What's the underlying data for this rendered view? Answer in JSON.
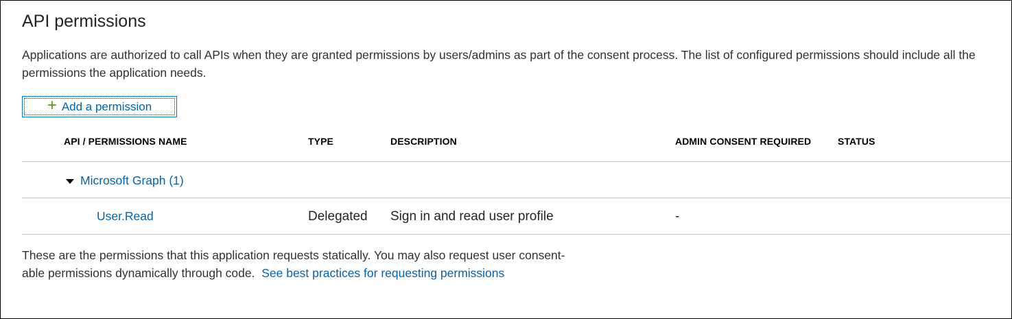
{
  "page": {
    "title": "API permissions",
    "intro": "Applications are authorized to call APIs when they are granted permissions by users/admins as part of the consent process. The list of configured permissions should include all the permissions the application needs."
  },
  "toolbar": {
    "add_permission_icon": "+",
    "add_permission_label": "Add a permission"
  },
  "table": {
    "columns": [
      "API / PERMISSIONS NAME",
      "TYPE",
      "DESCRIPTION",
      "ADMIN CONSENT REQUIRED",
      "STATUS"
    ],
    "groups": [
      {
        "label": "Microsoft Graph (1)",
        "rows": [
          {
            "name": "User.Read",
            "type": "Delegated",
            "description": "Sign in and read user profile",
            "admin_consent": "-",
            "status": ""
          }
        ]
      }
    ]
  },
  "footer": {
    "line1": "These are the permissions that this application requests statically. You may also request user consent-",
    "line2": "able permissions dynamically through code.",
    "link": "See best practices for requesting permissions"
  },
  "colors": {
    "link": "#0063b1",
    "add_icon": "#57a300",
    "button_border": "#0078d4",
    "divider": "#c8c6c4"
  }
}
